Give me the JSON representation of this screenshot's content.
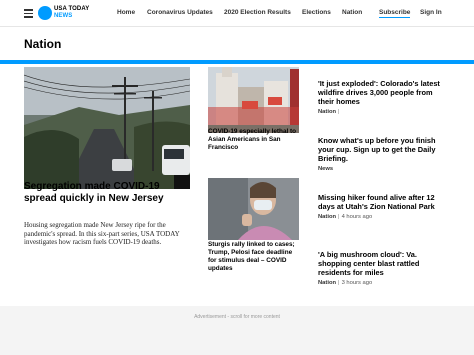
{
  "header": {
    "logo_line1": "USA TODAY",
    "logo_line2": "NEWS",
    "nav": [
      "Home",
      "Coronavirus Updates",
      "2020 Election Results",
      "Elections",
      "Nation"
    ],
    "subscribe_label": "Subscribe",
    "signin_label": "Sign In",
    "accent_color": "#009bff"
  },
  "section": {
    "title": "Nation"
  },
  "main_story": {
    "title": "Segregation made COVID-19 spread quickly in New Jersey",
    "summary": "Housing segregation made New Jersey ripe for the pandemic's spread. In this six-part series, USA TODAY investigates how racism fuels COVID-19 deaths."
  },
  "middle_stories": [
    {
      "title": "COVID-19 especially lethal to Asian Americans in San Francisco"
    },
    {
      "title": "Sturgis rally linked to cases; Trump, Pelosi face deadline for stimulus deal – COVID updates"
    }
  ],
  "right_stories": [
    {
      "title": "'It just exploded': Colorado's latest wildfire drives 3,000 people from their homes",
      "category": "Nation",
      "time": ""
    },
    {
      "title": "Know what's up before you finish your cup. Sign up to get the Daily Briefing.",
      "category": "News",
      "time": ""
    },
    {
      "title": "Missing hiker found alive after 12 days at Utah's Zion National Park",
      "category": "Nation",
      "time": "4 hours ago"
    },
    {
      "title": "'A big mushroom cloud': Va. shopping center blast rattled residents for miles",
      "category": "Nation",
      "time": "3 hours ago"
    }
  ],
  "ad": {
    "label": "Advertisement - scroll for more content"
  }
}
